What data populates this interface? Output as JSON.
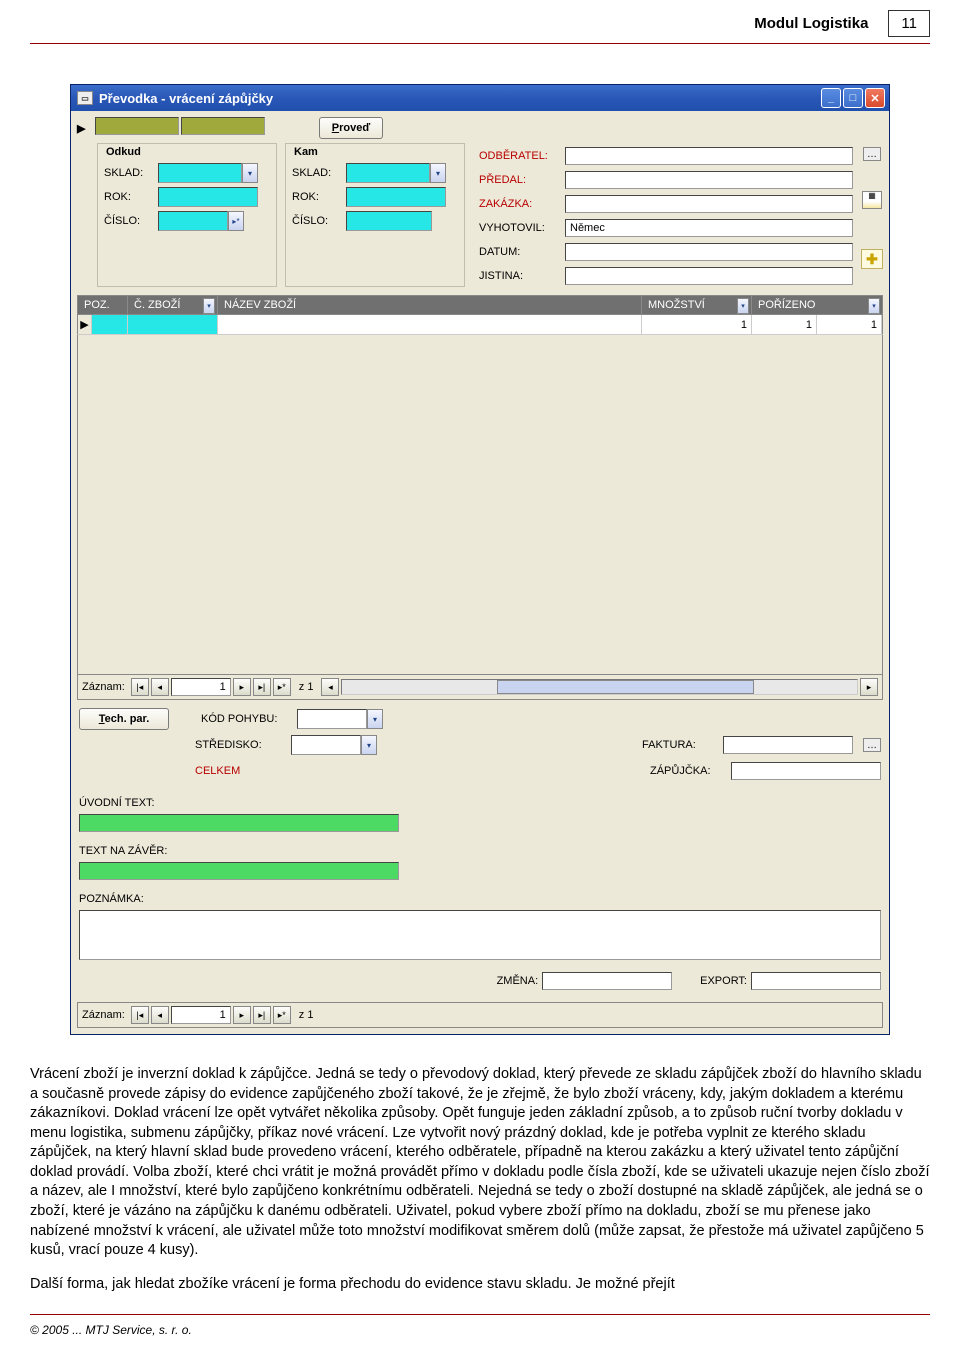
{
  "header": {
    "title": "Modul Logistika",
    "page_num": "11"
  },
  "window": {
    "title": "Převodka - vrácení zápůjčky",
    "proved_btn": "Proveď",
    "odkud": {
      "legend": "Odkud",
      "sklad_label": "SKLAD:",
      "rok_label": "ROK:",
      "cislo_label": "ČÍSLO:"
    },
    "kam": {
      "legend": "Kam",
      "sklad_label": "SKLAD:",
      "rok_label": "ROK:",
      "cislo_label": "ČÍSLO:"
    },
    "right": {
      "odberatel": "ODBĚRATEL:",
      "predal": "PŘEDAL:",
      "zakazka": "ZAKÁZKA:",
      "vyhotovil": "VYHOTOVIL:",
      "vyhotovil_value": "Němec",
      "datum": "DATUM:",
      "jistina": "JISTINA:"
    },
    "grid": {
      "poz": "POZ.",
      "czbozi": "Č. ZBOŽÍ",
      "nazev": "NÁZEV ZBOŽÍ",
      "mnozstvi": "MNOŽSTVÍ",
      "porizeno": "POŘÍZENO",
      "row_mnozstvi": "1",
      "row_porizeno_a": "1",
      "row_porizeno_b": "1"
    },
    "recnav_inner": {
      "label": "Záznam:",
      "value": "1",
      "of": "z 1"
    },
    "techpar_btn": "Tech. par.",
    "kod_pohybu": "KÓD POHYBU:",
    "stredisko": "STŘEDISKO:",
    "celkem": "CELKEM",
    "faktura": "FAKTURA:",
    "zapujcka": "ZÁPŮJČKA:",
    "uvodni_text": "ÚVODNÍ TEXT:",
    "text_na_zaver": "TEXT NA ZÁVĚR:",
    "poznamka": "POZNÁMKA:",
    "zmena": "ZMĚNA:",
    "export": "EXPORT:",
    "recnav_outer": {
      "label": "Záznam:",
      "value": "1",
      "of": "z 1"
    }
  },
  "paragraphs": {
    "p1": "Vrácení zboží je inverzní doklad k zápůjčce. Jedná se tedy o převodový doklad, který převede ze skladu zápůjček zboží do hlavního skladu a současně provede zápisy do evidence zapůjčeného zboží takové, že je zřejmě, že bylo zboží vráceny, kdy, jakým dokladem a kterému zákazníkovi. Doklad vrácení lze opět vytvářet několika způsoby. Opět funguje jeden základní způsob, a to způsob ruční tvorby dokladu v menu logistika, submenu zápůjčky, příkaz nové vrácení. Lze vytvořit nový prázdný doklad, kde je potřeba vyplnit ze kterého skladu zápůjček, na který hlavní sklad bude provedeno vrácení, kterého odběratele, případně na kterou zakázku a který uživatel tento zápůjční doklad provádí. Volba zboží, které chci vrátit je možná provádět přímo v dokladu podle čísla zboží, kde se uživateli ukazuje nejen číslo zboží a název, ale I množství, které bylo zapůjčeno konkrétnímu odběrateli. Nejedná se tedy o zboží dostupné na skladě zápůjček, ale jedná se o zboží, které je vázáno na zápůjčku k danému odběrateli. Uživatel, pokud vybere zboží přímo na dokladu, zboží se mu přenese jako nabízené množství k vrácení, ale uživatel může toto množství modifikovat směrem dolů (může zapsat, že přestože má uživatel zapůjčeno 5 kusů, vrací pouze 4 kusy).",
    "p2": "Další forma, jak hledat zbožíke vrácení je forma přechodu do evidence stavu skladu. Je možné přejít"
  },
  "footer": {
    "copyright": "© 2005 ... MTJ Service, s. r. o."
  }
}
